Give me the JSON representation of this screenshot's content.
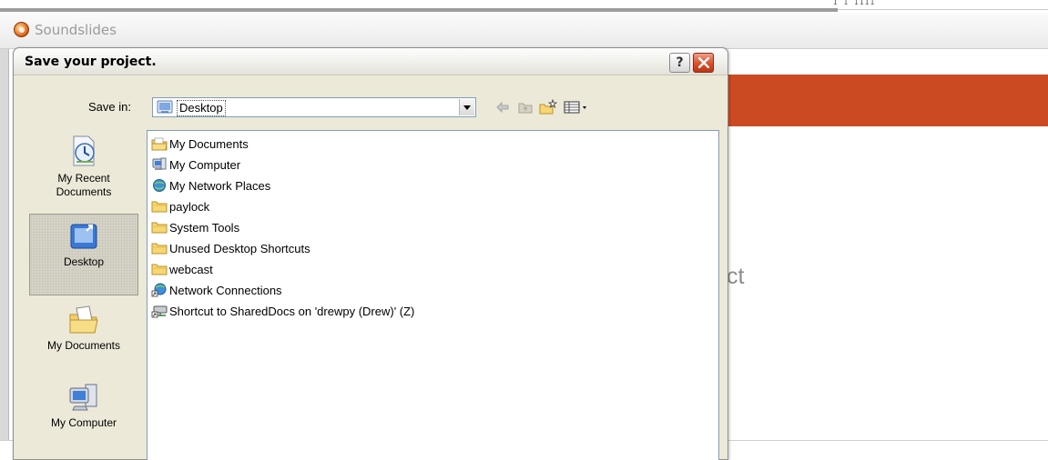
{
  "app": {
    "title": "Soundslides",
    "partial_text": "ct",
    "top_glyphs": "I I IIII",
    "banner_color": "#cc4a22"
  },
  "dialog": {
    "title": "Save your project.",
    "help_label": "?",
    "save_in_label": "Save in:",
    "save_in_value": "Desktop",
    "toolbar_icons": [
      "back-arrow-icon",
      "up-folder-icon",
      "new-folder-icon",
      "views-menu-icon"
    ]
  },
  "places": [
    {
      "label": "My Recent Documents",
      "icon": "recent-documents-icon",
      "selected": false
    },
    {
      "label": "Desktop",
      "icon": "desktop-icon",
      "selected": true
    },
    {
      "label": "My Documents",
      "icon": "my-documents-icon",
      "selected": false
    },
    {
      "label": "My Computer",
      "icon": "my-computer-icon",
      "selected": false
    }
  ],
  "files": [
    {
      "name": "My Documents",
      "icon": "my-documents-folder-icon"
    },
    {
      "name": "My Computer",
      "icon": "computer-icon"
    },
    {
      "name": "My Network Places",
      "icon": "network-places-icon"
    },
    {
      "name": "paylock",
      "icon": "folder-icon"
    },
    {
      "name": "System Tools",
      "icon": "folder-icon"
    },
    {
      "name": "Unused Desktop Shortcuts",
      "icon": "folder-icon"
    },
    {
      "name": "webcast",
      "icon": "folder-icon"
    },
    {
      "name": "Network Connections",
      "icon": "network-connections-icon"
    },
    {
      "name": "Shortcut to SharedDocs on 'drewpy (Drew)' (Z)",
      "icon": "network-drive-shortcut-icon"
    }
  ],
  "colors": {
    "dialog_bg": "#ece9d8",
    "close_red": "#d94f2b",
    "list_border": "#7f9db9"
  }
}
